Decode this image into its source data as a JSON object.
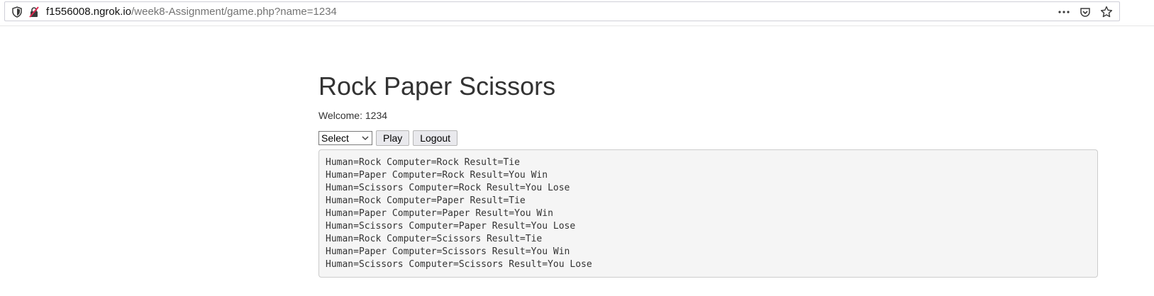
{
  "browser": {
    "url_host": "f1556008.ngrok.io",
    "url_path": "/week8-Assignment/game.php?name=1234",
    "icons": [
      "shield-icon",
      "insecure-lock-icon",
      "more-icon",
      "pocket-icon",
      "bookmark-star-icon"
    ]
  },
  "page": {
    "title": "Rock Paper Scissors",
    "welcome": "Welcome: 1234",
    "select_value": "Select",
    "play_label": "Play",
    "logout_label": "Logout",
    "results": [
      "Human=Rock Computer=Rock Result=Tie",
      "Human=Paper Computer=Rock Result=You Win",
      "Human=Scissors Computer=Rock Result=You Lose",
      "Human=Rock Computer=Paper Result=Tie",
      "Human=Paper Computer=Paper Result=You Win",
      "Human=Scissors Computer=Paper Result=You Lose",
      "Human=Rock Computer=Scissors Result=Tie",
      "Human=Paper Computer=Scissors Result=You Win",
      "Human=Scissors Computer=Scissors Result=You Lose"
    ]
  },
  "colors": {
    "text": "#333333",
    "pre_background": "#f5f5f5",
    "button_background": "#e9e9ed"
  }
}
